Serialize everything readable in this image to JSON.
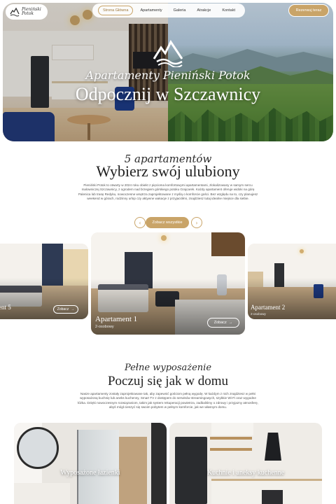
{
  "nav": {
    "brand_line1": "Pieniński",
    "brand_line2": "Potok",
    "items": [
      "Strona Główna",
      "Apartamenty",
      "Galeria",
      "Atrakcje",
      "Kontakt"
    ],
    "reserve_label": "Rezerwuj teraz"
  },
  "hero": {
    "brand": "Apartamenty Pieniński Potok",
    "title": "Odpocznij w Szczawnicy"
  },
  "apartments": {
    "script": "5 apartamentów",
    "title": "Wybierz swój ulubiony",
    "description": "Pieniński Potok to otwarty w 2024 roku obiekt z pięcioma komfortowymi apartamentami, zlokalizowany w samym sercu malowniczej Szczawnicy, z ogrodem nad brzegiem górskiego potoku Grajcarek. Każdy apartament oferuje widoki na górę Palenica lub trasę Redyku, nowoczesne wnętrza zaprojektowane z myślą o komforcie gości. Bez względu na to, czy planujesz weekend w górach, rodzinny urlop czy aktywne wakacje z przyjaciółmi, znajdziesz tutaj idealne miejsce dla siebie.",
    "see_all_label": "Zobacz wszystkie",
    "prev_icon": "‹",
    "next_icon": "›",
    "cards": [
      {
        "name": "ent 5",
        "button": "Zobacz"
      },
      {
        "name": "Apartament 1",
        "sub": "2-osobowy",
        "button": "Zobacz"
      },
      {
        "name": "Apartament 2",
        "sub": "2-osobowy"
      }
    ]
  },
  "equipment": {
    "script": "Pełne wyposażenie",
    "title": "Poczuj się jak w domu",
    "description": "Nasze apartamenty zostały zaprojektowane tak, aby zapewnić gościom pełną wygodę. W każdym z nich znajdziesz w pełni wyposażoną kuchnię lub aneks kuchenny, Smart TV z dostępem do serwisów streamingowych, szybkie Wi-Fi oraz wygodne łóżka. Dzięki nowoczesnym rozwiązaniom, takim jak system rekuperacji powietrza, zadbaliśmy o zdrowy i przyjazny atmosferę, abyś mógł cieszyć się swoim pobytem w pełnym komforcie, jak we własnym domu.",
    "features": [
      "Wyposażone łazienki",
      "Kuchnie i aneksy kuchenne"
    ]
  },
  "colors": {
    "accent": "#c9a468",
    "text": "#1f1f1f"
  }
}
